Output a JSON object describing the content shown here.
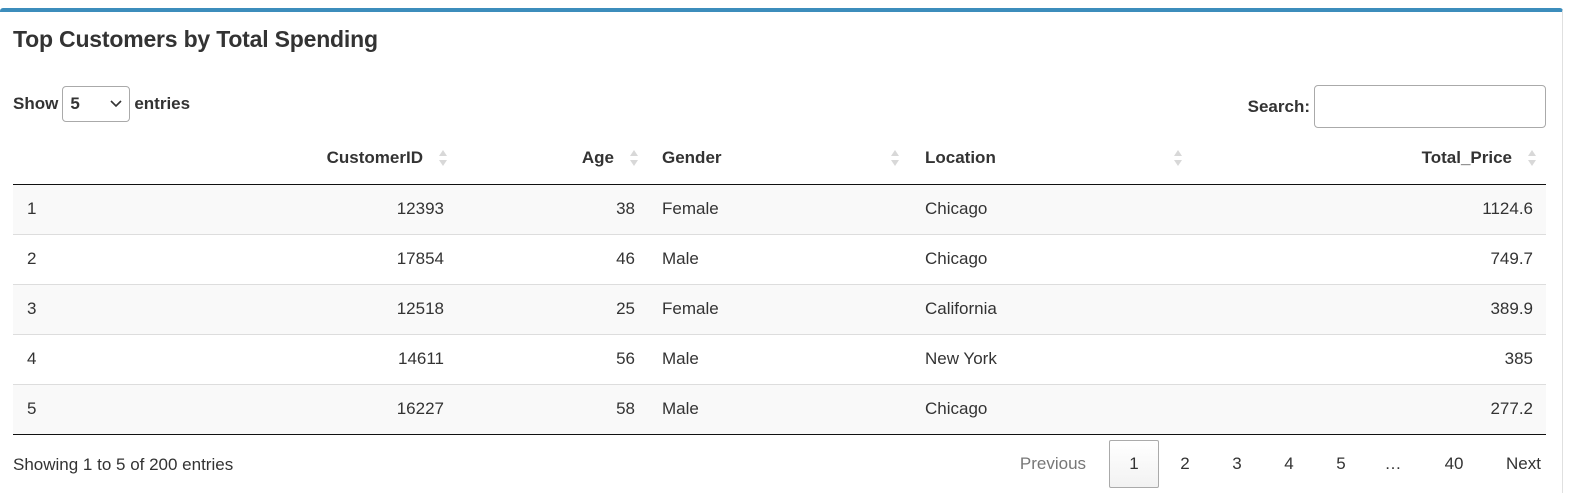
{
  "panel": {
    "title": "Top Customers by Total Spending"
  },
  "length_control": {
    "prefix": "Show",
    "selected": "5",
    "suffix": "entries"
  },
  "search": {
    "label": "Search:",
    "value": "",
    "placeholder": ""
  },
  "table": {
    "columns": [
      "",
      "CustomerID",
      "Age",
      "Gender",
      "Location",
      "Total_Price"
    ],
    "rows": [
      [
        "1",
        "12393",
        "38",
        "Female",
        "Chicago",
        "1124.6"
      ],
      [
        "2",
        "17854",
        "46",
        "Male",
        "Chicago",
        "749.7"
      ],
      [
        "3",
        "12518",
        "25",
        "Female",
        "California",
        "389.9"
      ],
      [
        "4",
        "14611",
        "56",
        "Male",
        "New York",
        "385"
      ],
      [
        "5",
        "16227",
        "58",
        "Male",
        "Chicago",
        "277.2"
      ]
    ]
  },
  "footer": {
    "info": "Showing 1 to 5 of 200 entries"
  },
  "pagination": {
    "previous": "Previous",
    "pages": [
      "1",
      "2",
      "3",
      "4",
      "5",
      "…",
      "40"
    ],
    "current": "1",
    "next": "Next"
  },
  "colors": {
    "accent": "#3c8dbc",
    "sort_arrow": "#d8d8d8",
    "row_stripe": "#f9f9f9"
  },
  "icons": {
    "select_chevron": "chevron-down-icon",
    "sort": "sort-both-icon"
  }
}
